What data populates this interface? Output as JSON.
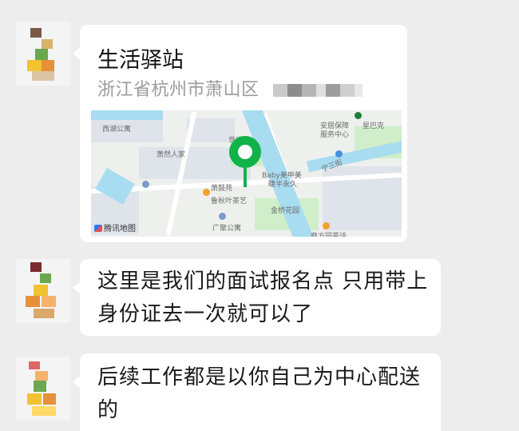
{
  "location_card": {
    "title": "生活驿站",
    "address": "浙江省杭州市萧山区",
    "map": {
      "labels": [
        "西湖公寓",
        "萧然人家",
        "世纪",
        "萧鼓苑",
        "鲁秋叶茶艺",
        "Baby美甲美",
        "睫半永久",
        "安居保障",
        "服务中心",
        "星巴克",
        "广聚公寓",
        "金桥花园",
        "翡方园茶话",
        "宁三街"
      ],
      "brand": "腾讯地图"
    }
  },
  "messages": [
    {
      "text_line1": "这里是我们的面试报名点 只用带上",
      "text_line2": "身份证去一次就可以了"
    },
    {
      "text_line1": "后续工作都是以你自己为中心配送",
      "text_line2": "的"
    }
  ],
  "colors": {
    "background": "#ededed",
    "bubble": "#ffffff",
    "pin": "#12b24a",
    "water": "#a8dcf0"
  }
}
